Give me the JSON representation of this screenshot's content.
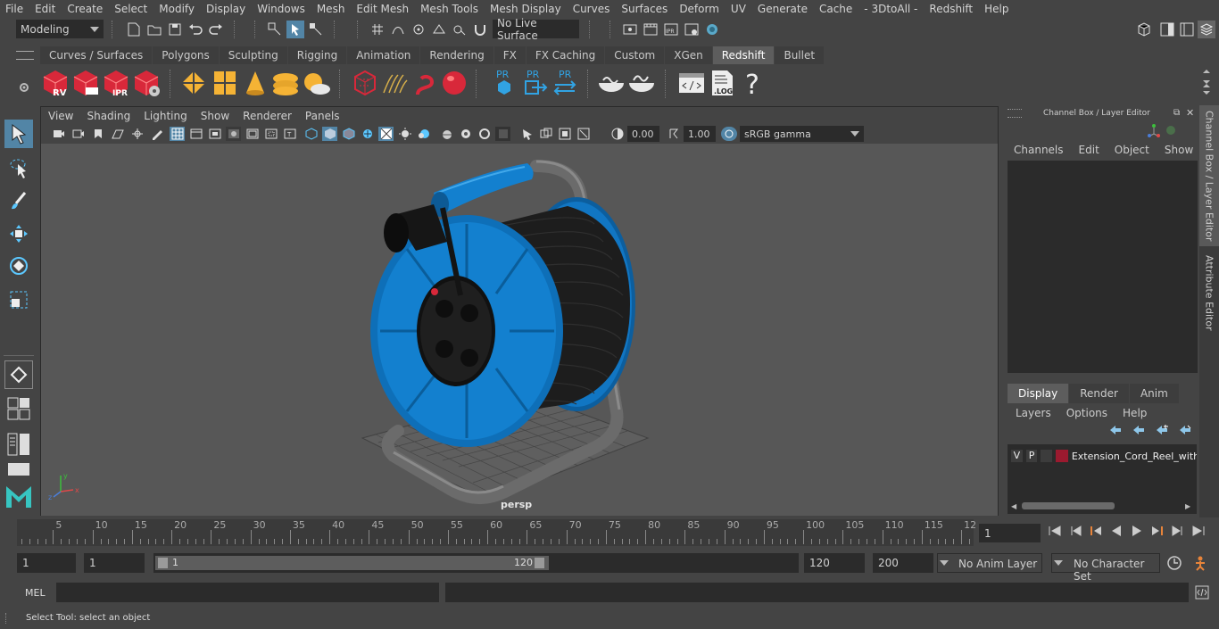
{
  "menu": [
    "File",
    "Edit",
    "Create",
    "Select",
    "Modify",
    "Display",
    "Windows",
    "Mesh",
    "Edit Mesh",
    "Mesh Tools",
    "Mesh Display",
    "Curves",
    "Surfaces",
    "Deform",
    "UV",
    "Generate",
    "Cache",
    "- 3DtoAll -",
    "Redshift",
    "Help"
  ],
  "statusline": {
    "workspace": "Modeling",
    "live_surface": "No Live Surface"
  },
  "shelf_tabs": [
    "Curves / Surfaces",
    "Polygons",
    "Sculpting",
    "Rigging",
    "Animation",
    "Rendering",
    "FX",
    "FX Caching",
    "Custom",
    "XGen",
    "Redshift",
    "Bullet"
  ],
  "shelf_active": "Redshift",
  "shelf_icon_labels": {
    "rv": "RV",
    "ipr": "IPR",
    "pr": "PR",
    "log": ".LOG",
    "help": "?"
  },
  "viewport": {
    "menu": [
      "View",
      "Shading",
      "Lighting",
      "Show",
      "Renderer",
      "Panels"
    ],
    "exposure": "0.00",
    "gamma": "1.00",
    "color_space": "sRGB gamma",
    "camera_label": "persp"
  },
  "channel_box": {
    "title": "Channel Box / Layer Editor",
    "menu": [
      "Channels",
      "Edit",
      "Object",
      "Show"
    ],
    "tabs": [
      "Display",
      "Render",
      "Anim"
    ],
    "active_tab": "Display",
    "layer_menu": [
      "Layers",
      "Options",
      "Help"
    ],
    "layer": {
      "v": "V",
      "p": "P",
      "name": "Extension_Cord_Reel_with",
      "color": "#9b1a2f"
    }
  },
  "side_tabs": [
    "Channel Box / Layer Editor",
    "Attribute Editor"
  ],
  "timeline": {
    "ticks": [
      "5",
      "10",
      "15",
      "20",
      "25",
      "30",
      "35",
      "40",
      "45",
      "50",
      "55",
      "60",
      "65",
      "70",
      "75",
      "80",
      "85",
      "90",
      "95",
      "100",
      "105",
      "110",
      "115",
      "12"
    ],
    "start_label": "1",
    "current_frame": "1"
  },
  "range": {
    "start": "1",
    "start2": "1",
    "slider_start": "1",
    "slider_end": "120",
    "end": "120",
    "end2": "200",
    "anim_layer": "No Anim Layer",
    "character_set": "No Character Set"
  },
  "cmd": {
    "label": "MEL"
  },
  "help_line": "Select Tool: select an object",
  "colors": {
    "accent": "#5285a6",
    "reel_blue": "#0f6fb8",
    "redshift_red": "#d8283a"
  }
}
